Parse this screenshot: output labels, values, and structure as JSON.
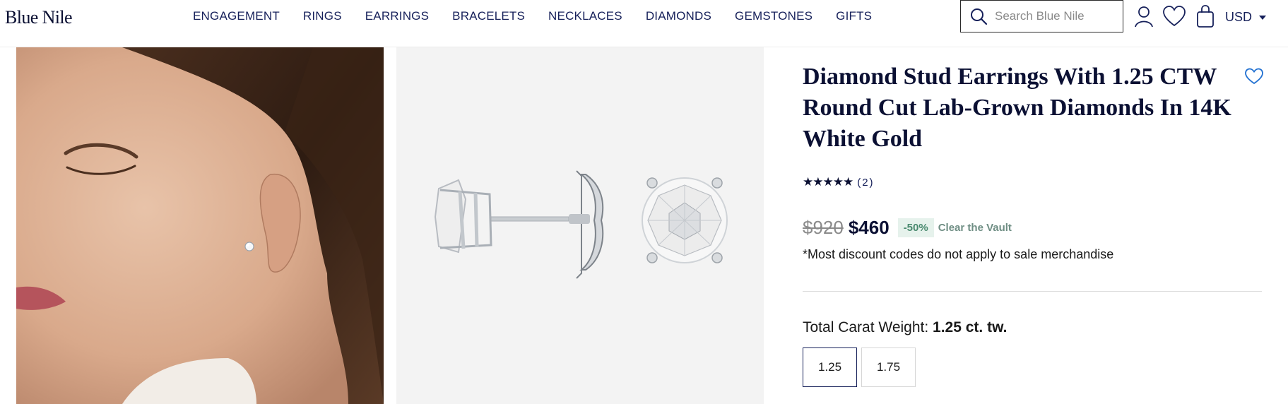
{
  "header": {
    "logo": "Blue Nile",
    "nav": [
      "ENGAGEMENT",
      "RINGS",
      "EARRINGS",
      "BRACELETS",
      "NECKLACES",
      "DIAMONDS",
      "GEMSTONES",
      "GIFTS"
    ],
    "search_placeholder": "Search Blue Nile",
    "icons": [
      "search-icon",
      "account-icon",
      "heart-icon",
      "bag-icon"
    ],
    "currency": "USD"
  },
  "product": {
    "title": "Diamond Stud Earrings With 1.25 CTW Round Cut Lab-Grown Diamonds In 14K White Gold",
    "rating_stars": "★★★★★",
    "rating_value": 5,
    "review_count": "(2)",
    "price_original": "$920",
    "price_sale": "$460",
    "discount_badge": "-50%",
    "discount_label": "Clear the Vault",
    "disclaimer": "*Most discount codes do not apply to sale merchandise",
    "carat_label": "Total Carat Weight:",
    "carat_selected": "1.25 ct. tw.",
    "carat_options": [
      "1.25",
      "1.75"
    ],
    "carat_selected_index": 0
  },
  "colors": {
    "brand_navy": "#0b1033",
    "nav_text": "#16205a",
    "badge_bg": "#e6f2ec",
    "badge_text": "#4a8a6f",
    "wishlist_accent": "#1f6fd1"
  }
}
